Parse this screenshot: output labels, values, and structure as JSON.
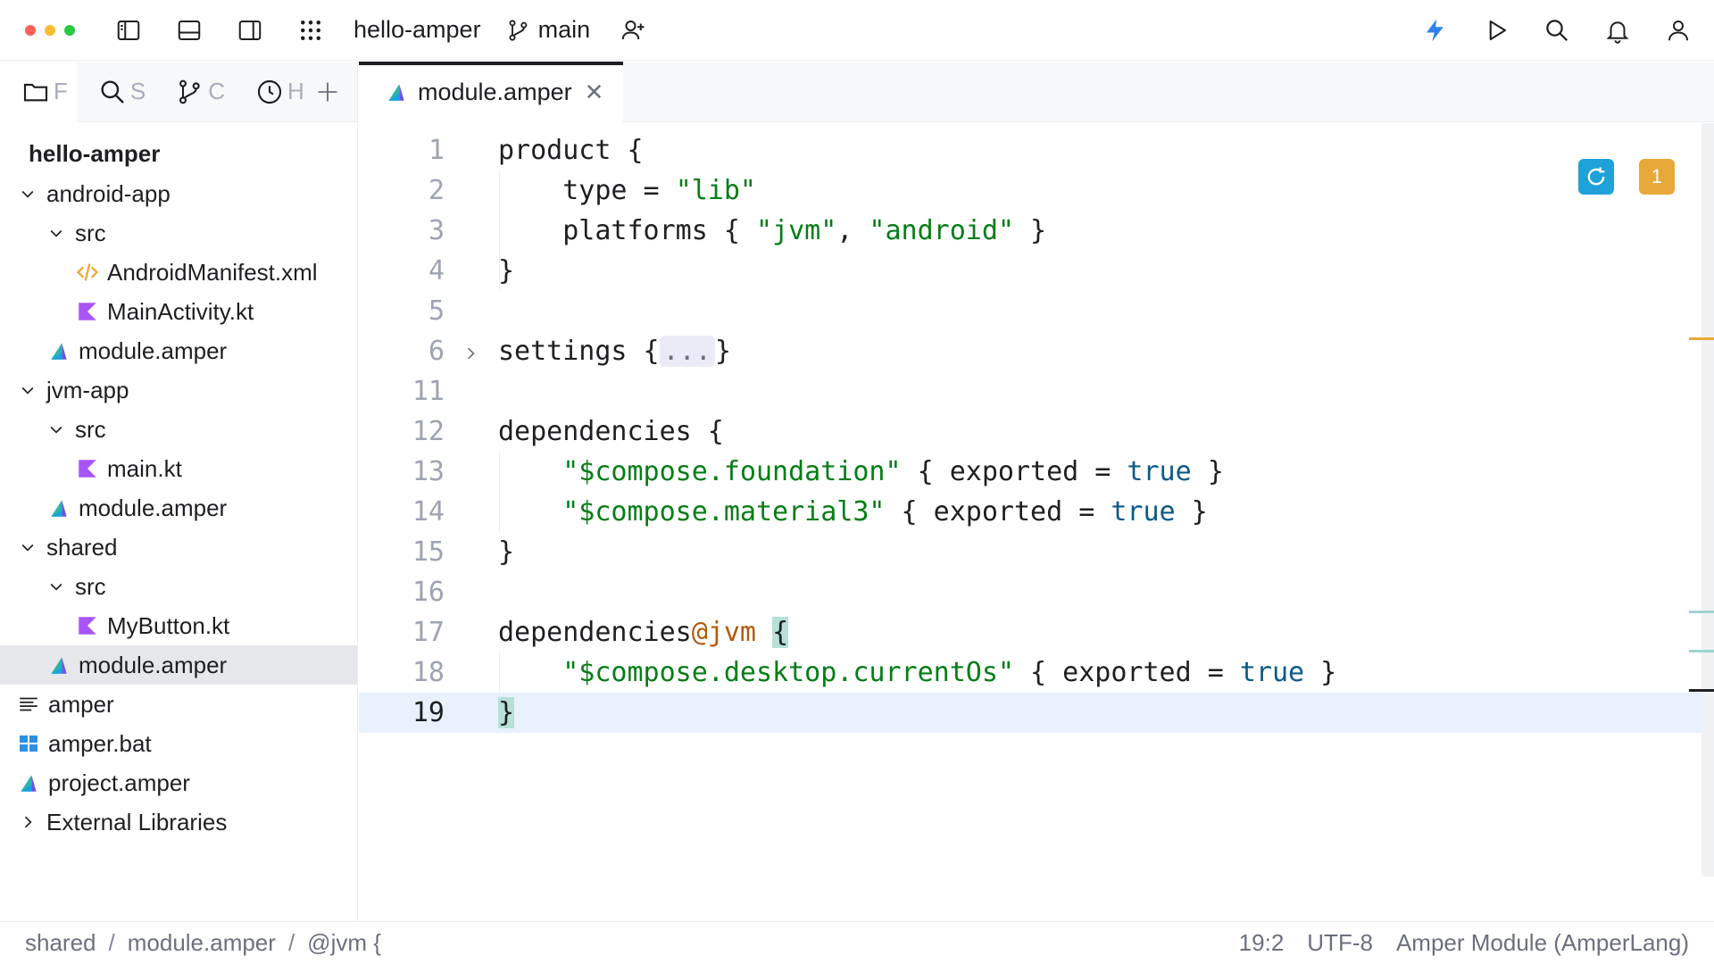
{
  "window": {
    "traffic_lights": {
      "close": "#ff5f57",
      "minimize": "#febc2e",
      "zoom": "#28c840"
    },
    "project": "hello-amper",
    "branch": "main"
  },
  "toolbar_icons": [
    "sidebar-left-icon",
    "bottom-panel-icon",
    "sidebar-right-icon",
    "apps-grid-icon",
    "add-user-icon",
    "lightning-icon",
    "run-icon",
    "search-icon",
    "bell-icon",
    "account-icon"
  ],
  "sidebar": {
    "tabs": [
      {
        "icon": "folder-icon",
        "label": "F"
      },
      {
        "icon": "search-icon",
        "label": "S"
      },
      {
        "icon": "branch-icon",
        "label": "C"
      },
      {
        "icon": "clock-icon",
        "label": "H"
      }
    ],
    "tree": [
      {
        "label": "hello-amper",
        "type": "root"
      },
      {
        "label": "android-app",
        "type": "folder",
        "depth": 0,
        "expanded": true
      },
      {
        "label": "src",
        "type": "folder",
        "depth": 1,
        "expanded": true
      },
      {
        "label": "AndroidManifest.xml",
        "type": "xml",
        "depth": 2
      },
      {
        "label": "MainActivity.kt",
        "type": "kotlin",
        "depth": 2
      },
      {
        "label": "module.amper",
        "type": "amper",
        "depth": 1
      },
      {
        "label": "jvm-app",
        "type": "folder",
        "depth": 0,
        "expanded": true
      },
      {
        "label": "src",
        "type": "folder",
        "depth": 1,
        "expanded": true
      },
      {
        "label": "main.kt",
        "type": "kotlin",
        "depth": 2
      },
      {
        "label": "module.amper",
        "type": "amper",
        "depth": 1
      },
      {
        "label": "shared",
        "type": "folder",
        "depth": 0,
        "expanded": true
      },
      {
        "label": "src",
        "type": "folder",
        "depth": 1,
        "expanded": true
      },
      {
        "label": "MyButton.kt",
        "type": "kotlin",
        "depth": 2
      },
      {
        "label": "module.amper",
        "type": "amper",
        "depth": 1,
        "selected": true
      },
      {
        "label": "amper",
        "type": "text",
        "depth": 0
      },
      {
        "label": "amper.bat",
        "type": "windows",
        "depth": 0
      },
      {
        "label": "project.amper",
        "type": "amper",
        "depth": 0
      },
      {
        "label": "External Libraries",
        "type": "folder",
        "depth": 0,
        "expanded": false
      }
    ]
  },
  "editor": {
    "tab": {
      "label": "module.amper"
    },
    "warning_count": "1",
    "lines": [
      {
        "n": "1",
        "tokens": [
          [
            "t",
            "product {"
          ]
        ]
      },
      {
        "n": "2",
        "tokens": [
          [
            "t",
            "    type = "
          ],
          [
            "s",
            "\"lib\""
          ]
        ]
      },
      {
        "n": "3",
        "tokens": [
          [
            "t",
            "    platforms { "
          ],
          [
            "s",
            "\"jvm\""
          ],
          [
            "t",
            ", "
          ],
          [
            "s",
            "\"android\""
          ],
          [
            "t",
            " }"
          ]
        ]
      },
      {
        "n": "4",
        "tokens": [
          [
            "t",
            "}"
          ]
        ]
      },
      {
        "n": "5",
        "tokens": []
      },
      {
        "n": "6",
        "fold": true,
        "tokens": [
          [
            "t",
            "settings {"
          ],
          [
            "f",
            "..."
          ],
          [
            "t",
            "}"
          ]
        ]
      },
      {
        "n": "11",
        "tokens": []
      },
      {
        "n": "12",
        "tokens": [
          [
            "t",
            "dependencies {"
          ]
        ]
      },
      {
        "n": "13",
        "tokens": [
          [
            "t",
            "    "
          ],
          [
            "s",
            "\"$compose.foundation\""
          ],
          [
            "t",
            " { exported = "
          ],
          [
            "k",
            "true"
          ],
          [
            "t",
            " }"
          ]
        ]
      },
      {
        "n": "14",
        "tokens": [
          [
            "t",
            "    "
          ],
          [
            "s",
            "\"$compose.material3\""
          ],
          [
            "t",
            " { exported = "
          ],
          [
            "k",
            "true"
          ],
          [
            "t",
            " }"
          ]
        ]
      },
      {
        "n": "15",
        "tokens": [
          [
            "t",
            "}"
          ]
        ]
      },
      {
        "n": "16",
        "tokens": []
      },
      {
        "n": "17",
        "tokens": [
          [
            "t",
            "dependencies"
          ],
          [
            "a",
            "@jvm"
          ],
          [
            "t",
            " "
          ],
          [
            "b",
            "{"
          ]
        ]
      },
      {
        "n": "18",
        "tokens": [
          [
            "t",
            "    "
          ],
          [
            "s",
            "\"$compose.desktop.currentOs\""
          ],
          [
            "t",
            " { exported = "
          ],
          [
            "k",
            "true"
          ],
          [
            "t",
            " }"
          ]
        ]
      },
      {
        "n": "19",
        "current": true,
        "tokens": [
          [
            "b",
            "}"
          ]
        ]
      }
    ],
    "scroll_marks": [
      {
        "color": "#e8a93a"
      },
      {
        "color": "#9fd3d0"
      },
      {
        "color": "#9fd3d0"
      },
      {
        "color": "#1e1f22"
      }
    ]
  },
  "statusbar": {
    "breadcrumbs": [
      "shared",
      "module.amper",
      "@jvm {"
    ],
    "separator": "/",
    "position": "19:2",
    "encoding": "UTF-8",
    "file_type": "Amper Module (AmperLang)"
  }
}
